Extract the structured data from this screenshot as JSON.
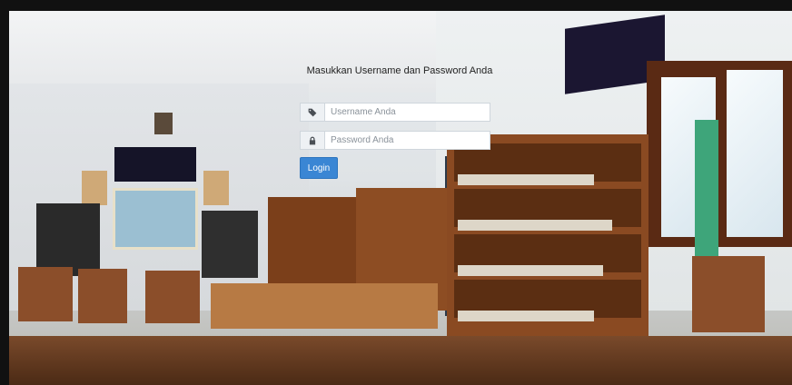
{
  "login": {
    "title": "Masukkan Username dan Password Anda",
    "username": {
      "placeholder": "Username Anda",
      "value": ""
    },
    "password": {
      "placeholder": "Password Anda",
      "value": ""
    },
    "submit_label": "Login"
  },
  "background": {
    "description_icons": [
      "tag-icon",
      "lock-icon"
    ],
    "colors": {
      "button": "#3a86d4",
      "addon": "#eef1f4"
    }
  }
}
